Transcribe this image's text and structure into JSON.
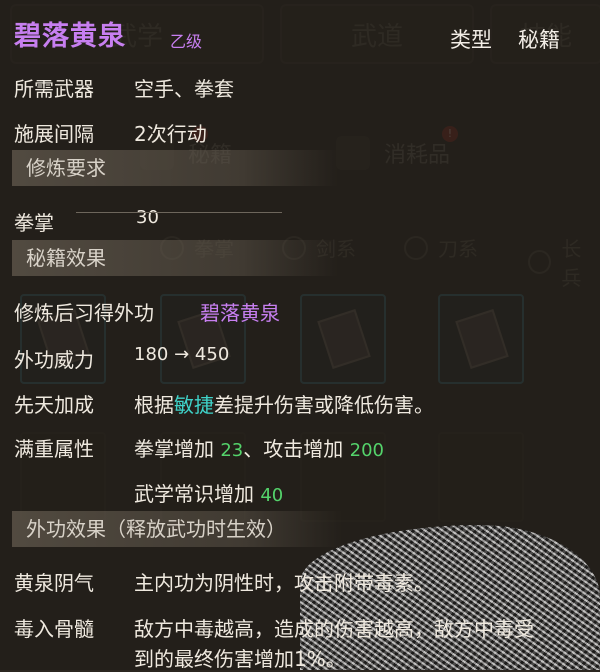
{
  "header": {
    "name": "碧落黄泉",
    "grade": "乙级",
    "type_label": "类型",
    "type_value": "秘籍"
  },
  "details": [
    {
      "label": "所需武器",
      "value": "空手、拳套"
    },
    {
      "label": "施展间隔",
      "value": "2次行动"
    }
  ],
  "requirements": {
    "title": "修炼要求",
    "items": [
      {
        "label": "拳掌",
        "value": "30"
      }
    ]
  },
  "effects": {
    "title": "秘籍效果",
    "learned_label": "修炼后习得外功",
    "learned_value": "碧落黄泉",
    "power_label": "外功威力",
    "power_from": "180",
    "power_arrow": "→",
    "power_to": "450",
    "innate_label": "先天加成",
    "innate_pre": "根据",
    "innate_attr": "敏捷",
    "innate_post": "差提升伤害或降低伤害。",
    "full_label": "满重属性",
    "full_line1_a": "拳掌增加 ",
    "full_line1_a_val": "23",
    "full_line1_b": "、攻击增加 ",
    "full_line1_b_val": "200",
    "full_line2_a": "武学常识增加 ",
    "full_line2_a_val": "40"
  },
  "skill_effects": {
    "title": "外功效果（释放武功时生效）",
    "items": [
      {
        "label": "黄泉阴气",
        "line1": "主内功为阴性时，攻击附带毒素。"
      },
      {
        "label": "毒入骨髓",
        "line1": "敌方中毒越高，造成的伤害越高，敌方中毒受",
        "line2": "到的最终伤害增加1%。"
      }
    ]
  },
  "background": {
    "tabs": [
      "武学",
      "武道",
      "技能"
    ],
    "categories": [
      "秘籍",
      "消耗品"
    ],
    "filters": [
      "拳掌",
      "剑系",
      "刀系",
      "长兵"
    ]
  },
  "colors": {
    "purple": "#c77ff0",
    "green": "#54d36b",
    "teal": "#3fd3c9"
  }
}
